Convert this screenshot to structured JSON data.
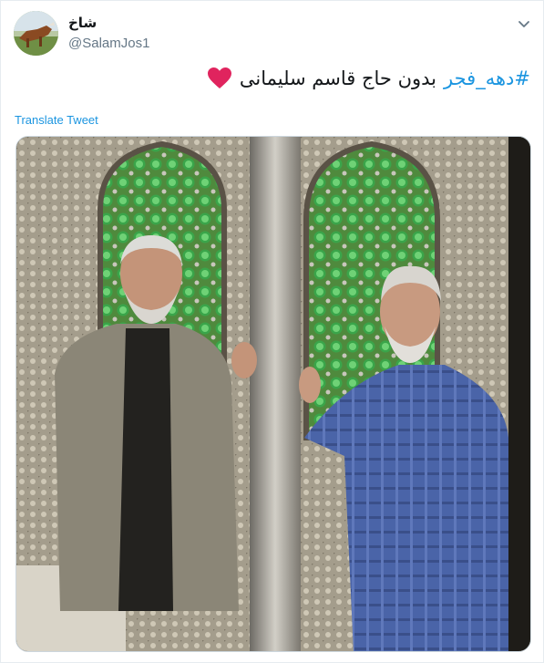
{
  "author": {
    "display_name": "شاخ",
    "handle": "@SalamJos1"
  },
  "tweet": {
    "hashtag": "#دهه_فجر",
    "text": "بدون حاج قاسم سلیمانی",
    "emoji": "red-heart-icon"
  },
  "translate_label": "Translate Tweet",
  "colors": {
    "link": "#1b95e0",
    "text": "#14171a",
    "muted": "#657786",
    "heart": "#e0245e"
  }
}
